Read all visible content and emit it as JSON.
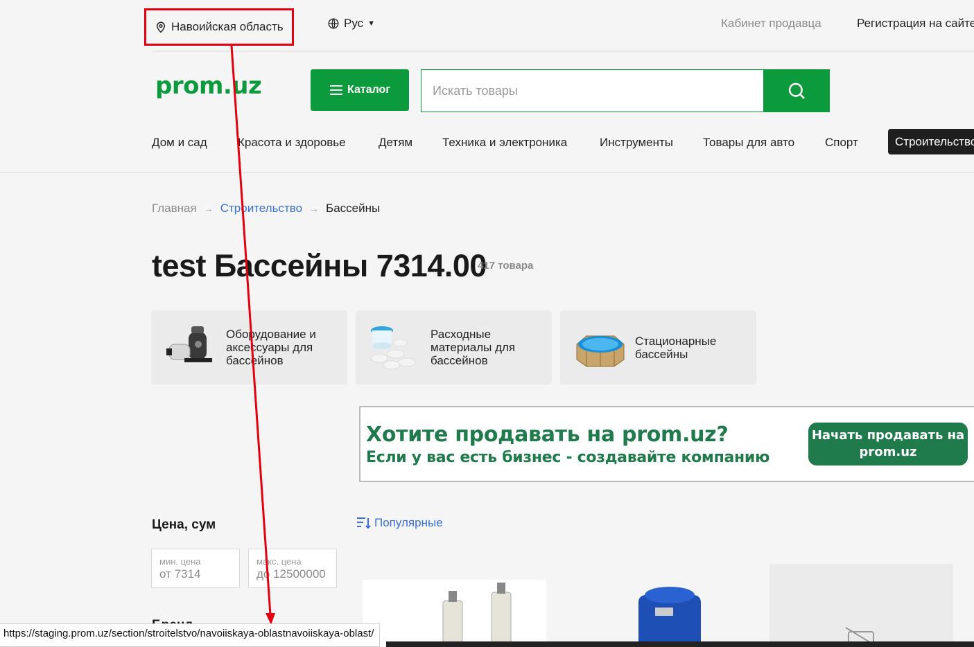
{
  "topbar": {
    "region": "Навоийская область",
    "language": "Рус",
    "seller_cabinet": "Кабинет продавца",
    "register": "Регистрация на сайте"
  },
  "header": {
    "logo": "prom.uz",
    "catalog_label": "Каталог",
    "search_placeholder": "Искать товары"
  },
  "categories": [
    "Дом и сад",
    "Красота и здоровье",
    "Детям",
    "Техника и электроника",
    "Инструменты",
    "Товары для авто",
    "Спорт",
    "Строительство"
  ],
  "breadcrumb": [
    "Главная",
    "Строительство",
    "Бассейны"
  ],
  "page": {
    "title": "test Бассейны 7314.00",
    "count": "417 товара"
  },
  "subcategories": [
    {
      "label": "Оборудование и аксессуары для бассейнов",
      "icon": "pool-pump-icon"
    },
    {
      "label": "Расходные материалы для бассейнов",
      "icon": "chlorine-tablets-icon"
    },
    {
      "label": "Стационарные бассейны",
      "icon": "wooden-pool-icon"
    }
  ],
  "banner": {
    "headline": "Хотите продавать на prom.uz?",
    "subline": "Если у вас есть бизнес - создавайте компанию",
    "cta": "Начать продавать на prom.uz"
  },
  "filters": {
    "price_heading": "Цена, сум",
    "min_placeholder": "мин. цена",
    "min_value": "от 7314",
    "max_placeholder": "макс. цена",
    "max_value": "до 12500000",
    "brand_heading": "Бренд"
  },
  "sort": {
    "label": "Популярные"
  },
  "statusbar": {
    "url": "https://staging.prom.uz/section/stroitelstvo/navoiiskaya-oblastnavoiiskaya-oblast/"
  },
  "colors": {
    "brand_green": "#0b9a3c",
    "banner_green": "#1f7a4c",
    "annotation_red": "#e3000f",
    "link_blue": "#3a6fd8"
  }
}
